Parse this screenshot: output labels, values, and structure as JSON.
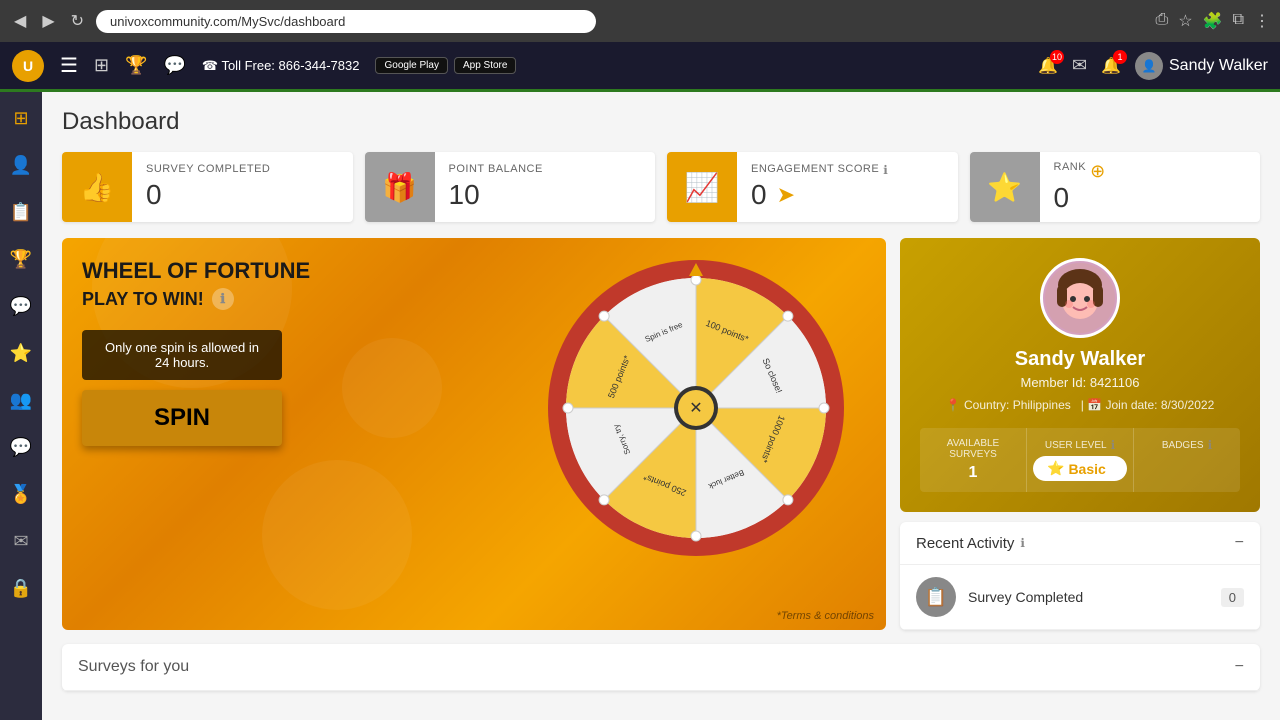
{
  "browser": {
    "url": "univoxcommunity.com/MySvc/dashboard",
    "back_icon": "◀",
    "forward_icon": "▶",
    "reload_icon": "↻"
  },
  "header": {
    "logo_text": "U",
    "phone_label": "☎ Toll Free: 866-344-7832",
    "store1": "Google Play",
    "store2": "App Store",
    "notif_count": "10",
    "mail_count": "1",
    "user_name": "Sandy Walker"
  },
  "sidebar": {
    "icons": [
      "⊞",
      "👤",
      "📋",
      "🏆",
      "💬",
      "🌟",
      "👥",
      "💬",
      "🏅",
      "✉",
      "🔒"
    ]
  },
  "page_title": "Dashboard",
  "stats": [
    {
      "label": "SURVEY COMPLETED",
      "value": "0",
      "icon": "👍",
      "color": "gold"
    },
    {
      "label": "POINT BALANCE",
      "value": "10",
      "icon": "🎁",
      "color": "gray"
    },
    {
      "label": "ENGAGEMENT SCORE",
      "value": "0",
      "icon": "📈",
      "color": "gold",
      "has_info": true
    },
    {
      "label": "RANK",
      "value": "0",
      "icon": "⭐",
      "color": "gray",
      "has_rank_arrow": true
    }
  ],
  "wheel": {
    "title": "WHEEL OF FORTUNE",
    "subtitle": "PLAY TO WIN!",
    "notice": "Only one spin is allowed in 24 hours.",
    "spin_label": "SPIN",
    "terms": "*Terms & conditions",
    "segments": [
      {
        "label": "100 points*",
        "color": "#f5c842"
      },
      {
        "label": "So close!",
        "color": "#ffffff"
      },
      {
        "label": "1000 points*",
        "color": "#f5c842"
      },
      {
        "label": "Better luck next time!",
        "color": "#ffffff"
      },
      {
        "label": "250 points*",
        "color": "#f5c842"
      },
      {
        "label": "Sorry, try again!",
        "color": "#ffffff"
      },
      {
        "label": "500 points*",
        "color": "#f5c842"
      },
      {
        "label": "Spin is free",
        "color": "#ffffff"
      }
    ]
  },
  "profile": {
    "name": "Sandy Walker",
    "member_id": "8421106",
    "country": "Philippines",
    "join_date": "8/30/2022",
    "available_surveys": "1",
    "user_level": "Basic",
    "user_level_label": "USER LEVEL",
    "available_surveys_label": "AVAILABLE SURVEYS",
    "badges_label": "BADGES"
  },
  "activity": {
    "title": "Recent Activity",
    "collapse_icon": "−",
    "items": [
      {
        "text": "Survey Completed",
        "count": "0",
        "icon": "📋"
      }
    ]
  },
  "surveys": {
    "title": "Surveys for you",
    "collapse_icon": "−"
  }
}
